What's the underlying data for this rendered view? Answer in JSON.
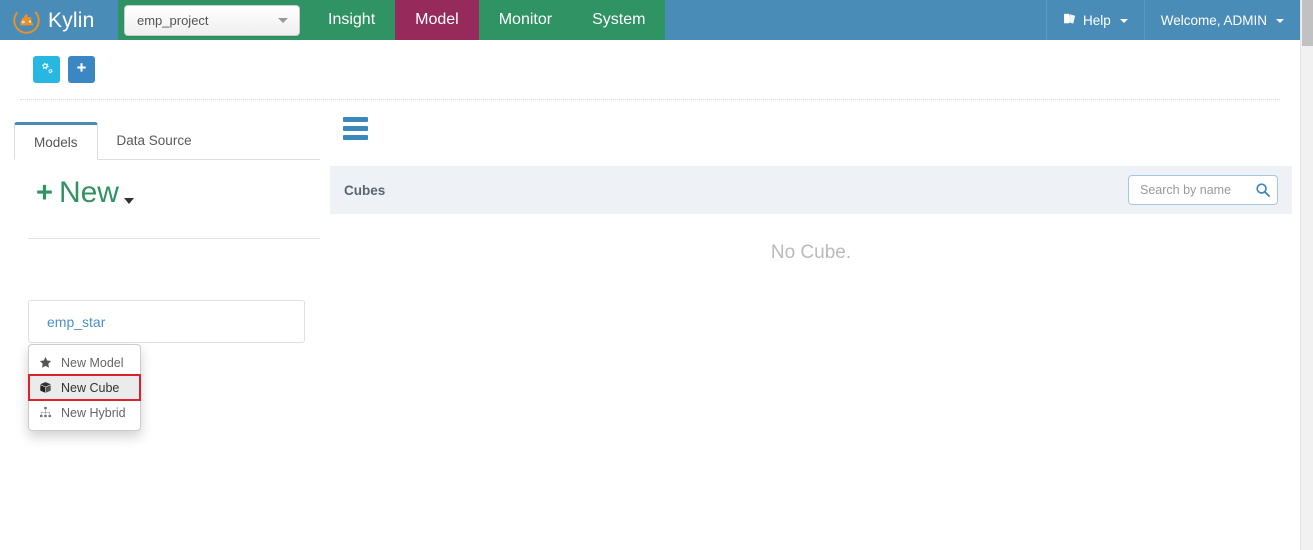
{
  "navbar": {
    "brand": "Kylin",
    "brand_logo_icon": "kylin-logo-icon",
    "project_selector": {
      "value": "emp_project",
      "caret_icon": "caret-down-icon"
    },
    "links": [
      {
        "label": "Insight",
        "active": false
      },
      {
        "label": "Model",
        "active": true
      },
      {
        "label": "Monitor",
        "active": false
      },
      {
        "label": "System",
        "active": false
      }
    ],
    "right_links": [
      {
        "label": "Help",
        "icon": "book-icon",
        "caret_icon": "caret-down-icon"
      },
      {
        "label": "Welcome, ADMIN",
        "icon": "",
        "caret_icon": "caret-down-icon"
      }
    ],
    "colors": {
      "brand_bg": "#4a8cb8",
      "nav_bg": "#2f9363",
      "active_bg": "#962a5b"
    }
  },
  "toolbar": {
    "buttons": [
      {
        "name": "manage-project-button",
        "icon": "cogs-icon",
        "color": "#27b7e0"
      },
      {
        "name": "add-project-button",
        "icon": "plus-icon",
        "color": "#3a87c4"
      }
    ]
  },
  "left_panel": {
    "tabs": [
      {
        "label": "Models",
        "active": true
      },
      {
        "label": "Data Source",
        "active": false
      }
    ],
    "new_button": {
      "label": "New",
      "plus_icon": "plus-icon",
      "caret_icon": "caret-down-icon"
    },
    "dropdown": {
      "items": [
        {
          "label": "New Model",
          "icon": "star-icon",
          "highlighted": false
        },
        {
          "label": "New Cube",
          "icon": "cube-icon",
          "highlighted": true
        },
        {
          "label": "New Hybrid",
          "icon": "sitemap-icon",
          "highlighted": false
        }
      ],
      "highlight_border_color": "#d9232d"
    },
    "models": [
      {
        "name": "emp_star"
      }
    ]
  },
  "right_panel": {
    "menu_icon": "hamburger-icon",
    "title": "Cubes",
    "search": {
      "placeholder": "Search by name",
      "value": "",
      "icon": "search-icon"
    },
    "empty_message": "No Cube."
  },
  "scrollbar": {
    "name": "page-scrollbar"
  }
}
